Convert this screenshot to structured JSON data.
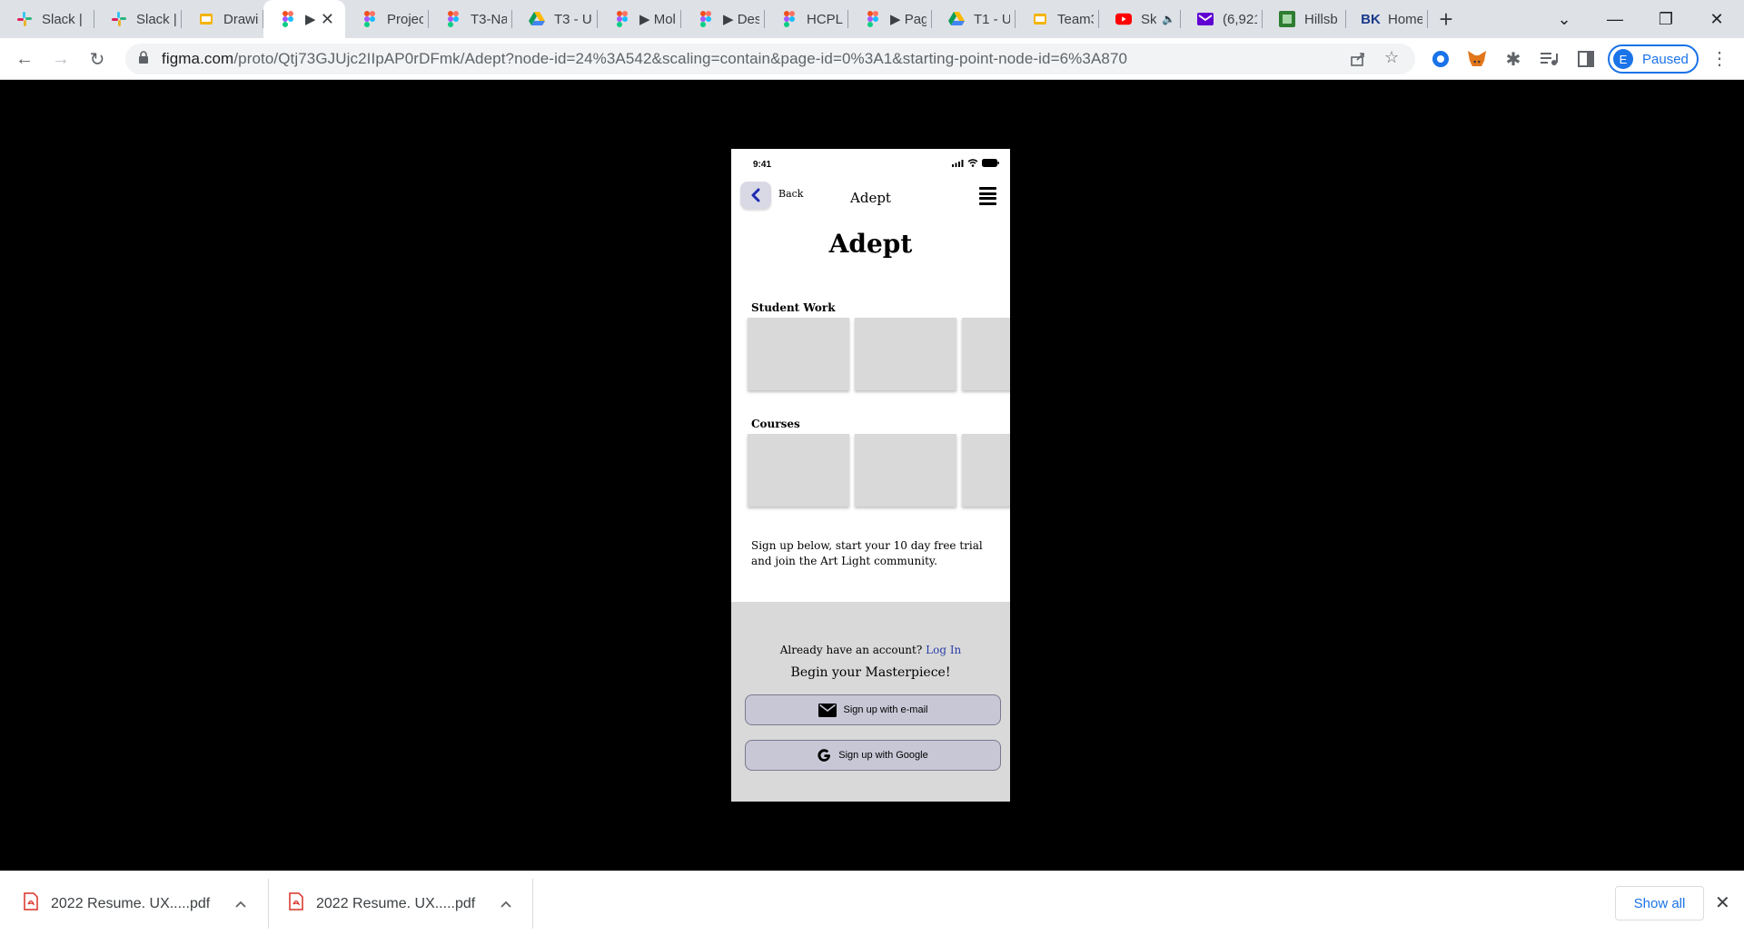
{
  "browser": {
    "tabs": [
      {
        "title": "Slack |",
        "icon": "slack-icon"
      },
      {
        "title": "Slack |",
        "icon": "slack-icon"
      },
      {
        "title": "Drawir",
        "icon": "slides-icon"
      },
      {
        "title": "▶",
        "icon": "figma-icon",
        "active": true
      },
      {
        "title": "Projec",
        "icon": "figma-icon"
      },
      {
        "title": "T3-Na",
        "icon": "figma-icon"
      },
      {
        "title": "T3 - U",
        "icon": "drive-icon"
      },
      {
        "title": "▶ Mol",
        "icon": "figma-icon"
      },
      {
        "title": "▶ Des",
        "icon": "figma-icon"
      },
      {
        "title": "HCPLC",
        "icon": "figma-icon"
      },
      {
        "title": "▶ Pag",
        "icon": "figma-icon"
      },
      {
        "title": "T1 - U",
        "icon": "drive-icon"
      },
      {
        "title": "Team3",
        "icon": "slides-icon"
      },
      {
        "title": "Sk",
        "icon": "youtube-icon"
      },
      {
        "title": "(6,921",
        "icon": "mail-icon"
      },
      {
        "title": "Hillsb",
        "icon": "hillsborough-icon"
      },
      {
        "title": "Home",
        "icon": "bk-icon"
      }
    ],
    "url_host": "figma.com",
    "url_path": "/proto/Qtj73GJUjc2IIpAP0rDFmk/Adept?node-id=24%3A542&scaling=contain&page-id=0%3A1&starting-point-node-id=6%3A870",
    "profile_initial": "E",
    "profile_label": "Paused",
    "accent": "#1a73e8"
  },
  "phone": {
    "status_time": "9:41",
    "back_label": "Back",
    "nav_title": "Adept",
    "page_title": "Adept",
    "section_student_work": "Student Work",
    "section_courses": "Courses",
    "signup_text": "Sign up below, start your 10 day free trial and join the Art Light community.",
    "already_text": "Already have an account?",
    "login_link": "Log In",
    "begin_text": "Begin your Masterpiece!",
    "email_button": "Sign up with e-mail",
    "google_button": "Sign up with Google"
  },
  "downloads": {
    "items": [
      {
        "name": "2022 Resume. UX.....pdf"
      },
      {
        "name": "2022 Resume. UX.....pdf"
      }
    ],
    "show_all": "Show all"
  }
}
